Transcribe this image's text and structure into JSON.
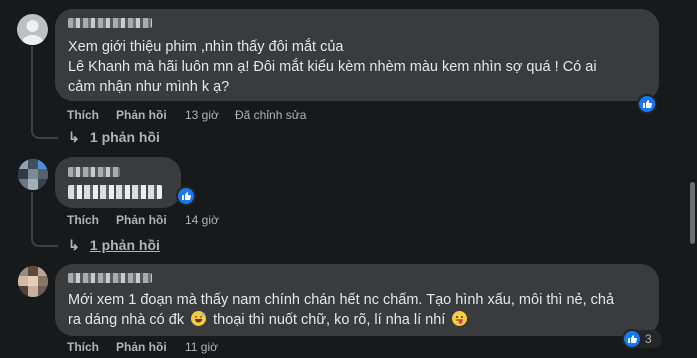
{
  "comments": [
    {
      "text_lines": [
        "Xem giới thiệu phim ,nhìn thấy đôi mắt của",
        "Lê Khanh mà hãi luôn mn ạ! Đôi mắt kiểu kèm nhèm màu kem nhìn sợ quá ! Có ai",
        "cảm nhận như mình k ạ?"
      ],
      "actions": {
        "like": "Thích",
        "reply": "Phản hồi",
        "time": "13 giờ",
        "edited": "Đã chỉnh sửa"
      },
      "reply_link": "1 phản hồi"
    },
    {
      "actions": {
        "like": "Thích",
        "reply": "Phản hồi",
        "time": "14 giờ"
      },
      "reply_link": "1 phản hồi"
    },
    {
      "text_lines": [
        "Mới xem 1 đoạn mà thấy nam chính chán hết nc chấm. Tạo hình xấu, môi thì nẻ, chả",
        "ra dáng nhà có đk",
        "thoại thì nuốt chữ, ko rõ, lí nha lí nhí"
      ],
      "actions": {
        "like": "Thích",
        "reply": "Phản hồi",
        "time": "11 giờ"
      },
      "reaction_count": "3"
    }
  ],
  "colors": {
    "background": "#18191a",
    "bubble": "#3a3b3c",
    "like_blue": "#1877f2"
  },
  "icons": [
    "avatar-default",
    "reply-arrow-icon",
    "like-icon",
    "laugh-sweat-emoji",
    "tongue-emoji"
  ]
}
